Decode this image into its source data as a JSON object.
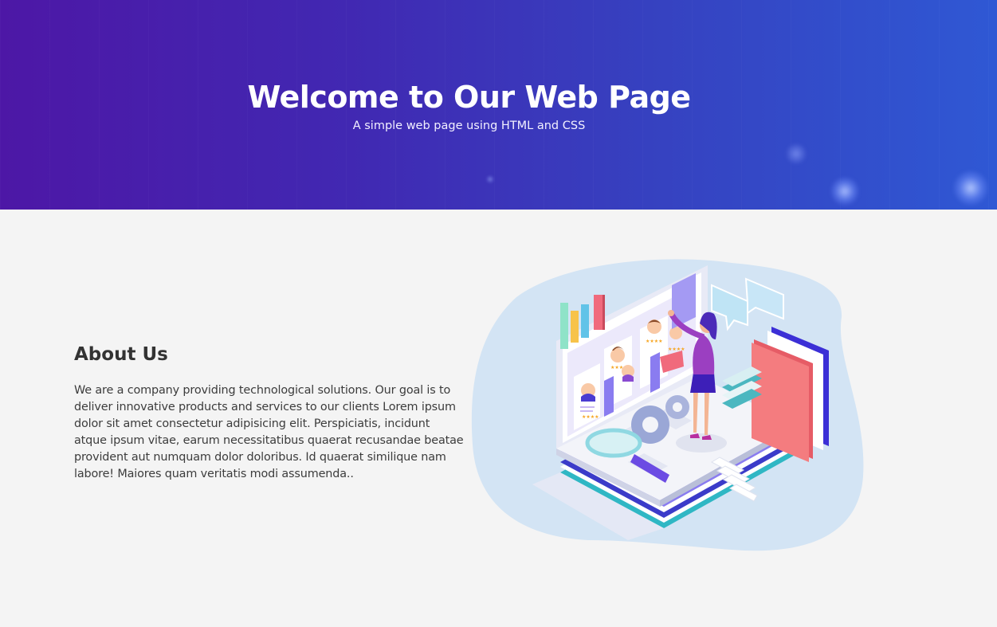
{
  "hero": {
    "title": "Welcome to Our Web Page",
    "subtitle": "A simple web page using HTML and CSS"
  },
  "about": {
    "heading": "About Us",
    "body": "We are a company providing technological solutions. Our goal is to deliver innovative products and services to our clients Lorem ipsum dolor sit amet consectetur adipisicing elit. Perspiciatis, incidunt atque ipsum vitae, earum necessitatibus quaerat recusandae beatae provident aut numquam dolor doloribus. Id quaerat similique nam labore! Maiores quam veritatis modi assumenda.."
  },
  "colors": {
    "hero_start": "#4d17a6",
    "hero_end": "#2f58d4",
    "page_bg": "#f4f4f4",
    "text_dark": "#333333"
  },
  "icons": {
    "illustration": "team-recruitment-illustration"
  }
}
